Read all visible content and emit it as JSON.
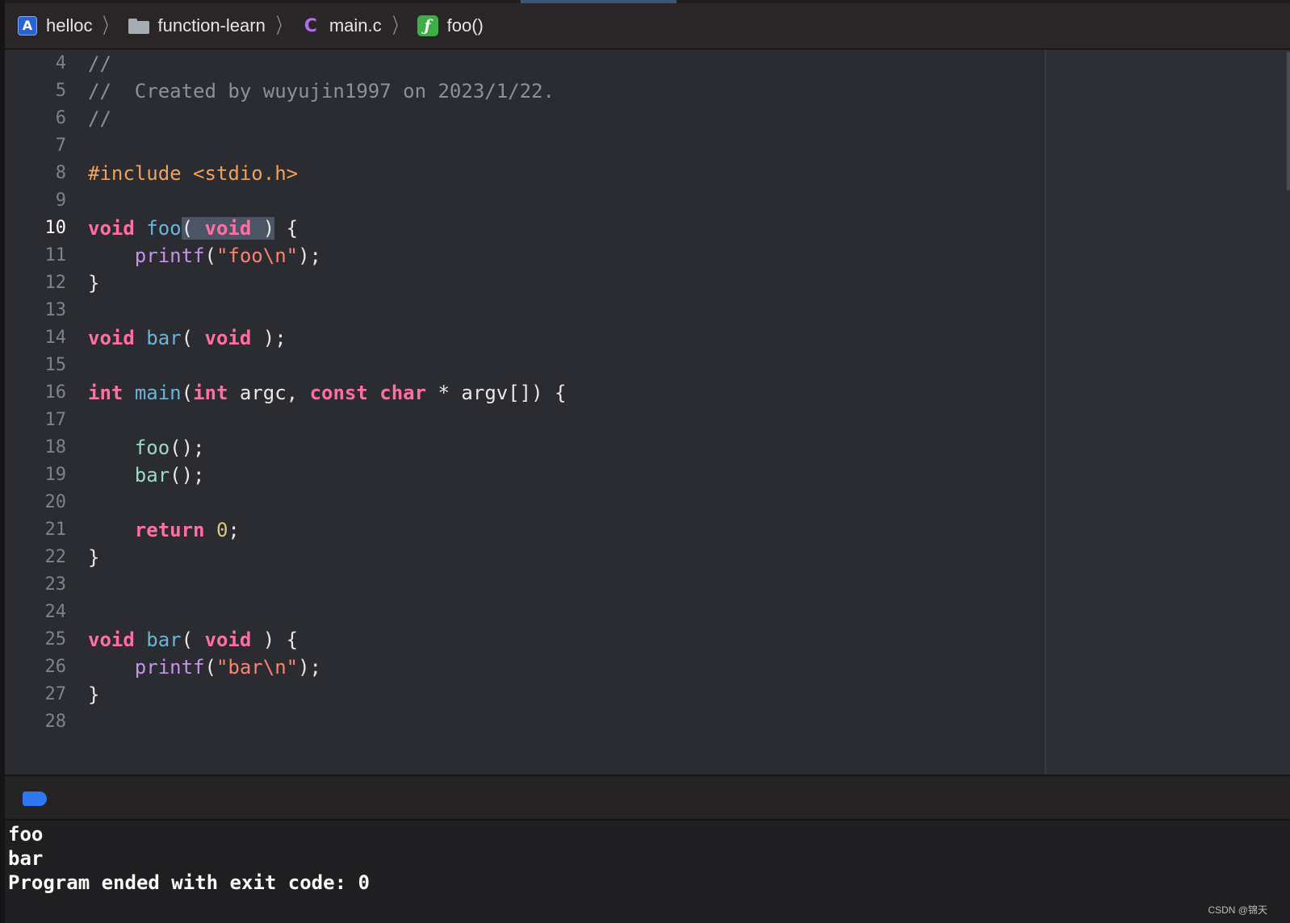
{
  "breadcrumb": {
    "items": [
      {
        "label": "helloc",
        "icon": "app-project-icon"
      },
      {
        "label": "function-learn",
        "icon": "folder-icon"
      },
      {
        "label": "main.c",
        "icon": "c-file-icon",
        "icon_text": "C"
      },
      {
        "label": "foo()",
        "icon": "function-icon",
        "icon_text": "ƒ"
      }
    ]
  },
  "editor": {
    "active_line": "10",
    "lines": [
      {
        "num": "4",
        "t1": "//"
      },
      {
        "num": "5",
        "t1": "//  Created by wuyujin1997 on 2023/1/22."
      },
      {
        "num": "6",
        "t1": "//"
      },
      {
        "num": "7"
      },
      {
        "num": "8",
        "t1": "#include <stdio.h>"
      },
      {
        "num": "9"
      },
      {
        "num": "10",
        "t1": "void",
        "t2": " ",
        "t3": "foo",
        "t4": "(",
        "t5": " ",
        "t6": "void",
        "t7": " )",
        "t8": " {"
      },
      {
        "num": "11",
        "t1": "    ",
        "t2": "printf",
        "t3": "(",
        "t4": "\"foo\\n\"",
        "t5": ");"
      },
      {
        "num": "12",
        "t1": "}"
      },
      {
        "num": "13"
      },
      {
        "num": "14",
        "t1": "void",
        "t2": " ",
        "t3": "bar",
        "t4": "( ",
        "t5": "void",
        "t6": " );"
      },
      {
        "num": "15"
      },
      {
        "num": "16",
        "t1": "int",
        "t2": " ",
        "t3": "main",
        "t4": "(",
        "t5": "int",
        "t6": " argc, ",
        "t7": "const",
        "t8": " ",
        "t9": "char",
        "t10": " * argv[]) {"
      },
      {
        "num": "17"
      },
      {
        "num": "18",
        "t1": "    ",
        "t2": "foo",
        "t3": "();"
      },
      {
        "num": "19",
        "t1": "    ",
        "t2": "bar",
        "t3": "();"
      },
      {
        "num": "20"
      },
      {
        "num": "21",
        "t1": "    ",
        "t2": "return",
        "t3": " ",
        "t4": "0",
        "t5": ";"
      },
      {
        "num": "22",
        "t1": "}"
      },
      {
        "num": "23"
      },
      {
        "num": "24"
      },
      {
        "num": "25",
        "t1": "void",
        "t2": " ",
        "t3": "bar",
        "t4": "( ",
        "t5": "void",
        "t6": " ) {"
      },
      {
        "num": "26",
        "t1": "    ",
        "t2": "printf",
        "t3": "(",
        "t4": "\"bar\\n\"",
        "t5": ");"
      },
      {
        "num": "27",
        "t1": "}"
      },
      {
        "num": "28"
      }
    ]
  },
  "console": {
    "output": [
      "foo",
      "bar",
      "Program ended with exit code: 0"
    ]
  },
  "watermark": "CSDN @锦天",
  "colors": {
    "keyword": "#ff6fa5",
    "function_decl": "#67b7dc",
    "function_call": "#9adbc4",
    "library_call": "#c792ea",
    "string": "#ff8170",
    "number": "#d9c97c",
    "comment": "#8b9099",
    "preprocessor": "#f0a15c",
    "selection": "#4c5566",
    "breakpoint_toggle": "#2f78f2"
  }
}
